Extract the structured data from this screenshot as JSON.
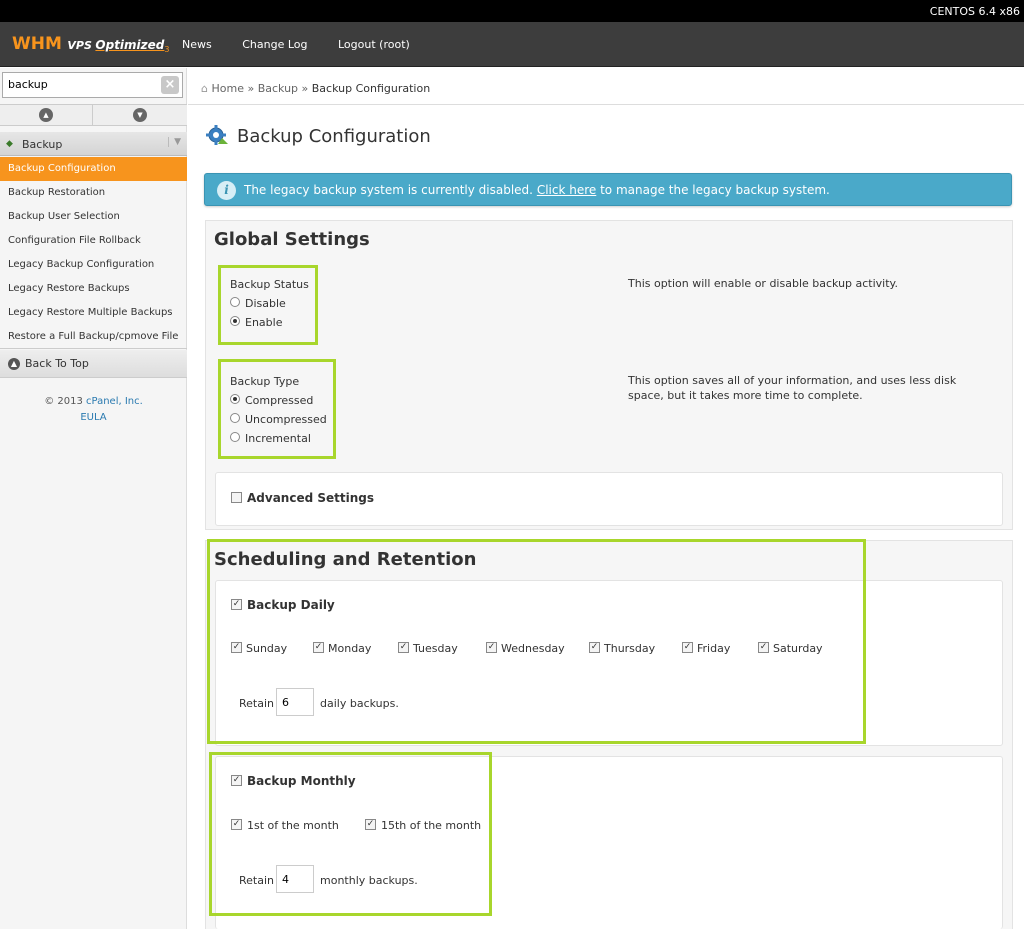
{
  "topbar": {
    "os_label": "CENTOS 6.4 x86"
  },
  "header": {
    "logo_whm": "WHM",
    "logo_vps": "VPS",
    "logo_optimized": "Optimized",
    "logo_version": "3",
    "nav": [
      "News",
      "Change Log",
      "Logout (root)"
    ]
  },
  "sidebar": {
    "search_value": "backup",
    "section_label": "Backup",
    "items": [
      {
        "label": "Backup Configuration",
        "active": true
      },
      {
        "label": "Backup Restoration"
      },
      {
        "label": "Backup User Selection"
      },
      {
        "label": "Configuration File Rollback"
      },
      {
        "label": "Legacy Backup Configuration"
      },
      {
        "label": "Legacy Restore Backups"
      },
      {
        "label": "Legacy Restore Multiple Backups"
      },
      {
        "label": "Restore a Full Backup/cpmove File"
      }
    ],
    "back_to_top": "Back To Top",
    "copyright": "© 2013",
    "company": "cPanel, Inc.",
    "eula": "EULA"
  },
  "breadcrumb": {
    "home": "Home",
    "sep": "»",
    "section": "Backup",
    "current": "Backup Configuration"
  },
  "page": {
    "title": "Backup Configuration",
    "info_pre": "The legacy backup system is currently disabled.",
    "info_link": "Click here",
    "info_post": "to manage the legacy backup system."
  },
  "global": {
    "heading": "Global Settings",
    "status_label": "Backup Status",
    "status_options": [
      "Disable",
      "Enable"
    ],
    "status_selected": "Enable",
    "status_help": "This option will enable or disable backup activity.",
    "type_label": "Backup Type",
    "type_options": [
      "Compressed",
      "Uncompressed",
      "Incremental"
    ],
    "type_selected": "Compressed",
    "type_help": "This option saves all of your information, and uses less disk space, but it takes more time to complete.",
    "advanced_label": "Advanced Settings"
  },
  "scheduling": {
    "heading": "Scheduling and Retention",
    "daily_label": "Backup Daily",
    "days": [
      "Sunday",
      "Monday",
      "Tuesday",
      "Wednesday",
      "Thursday",
      "Friday",
      "Saturday"
    ],
    "retain": "Retain",
    "daily_value": "6",
    "daily_suffix": "daily backups.",
    "monthly_label": "Backup Monthly",
    "monthly_days": [
      "1st of the month",
      "15th of the month"
    ],
    "monthly_value": "4",
    "monthly_suffix": "monthly backups."
  },
  "colors": {
    "accent": "#f7941d",
    "info": "#4aa9c9",
    "highlight": "#a8d62c",
    "header": "#3d3d3d"
  }
}
